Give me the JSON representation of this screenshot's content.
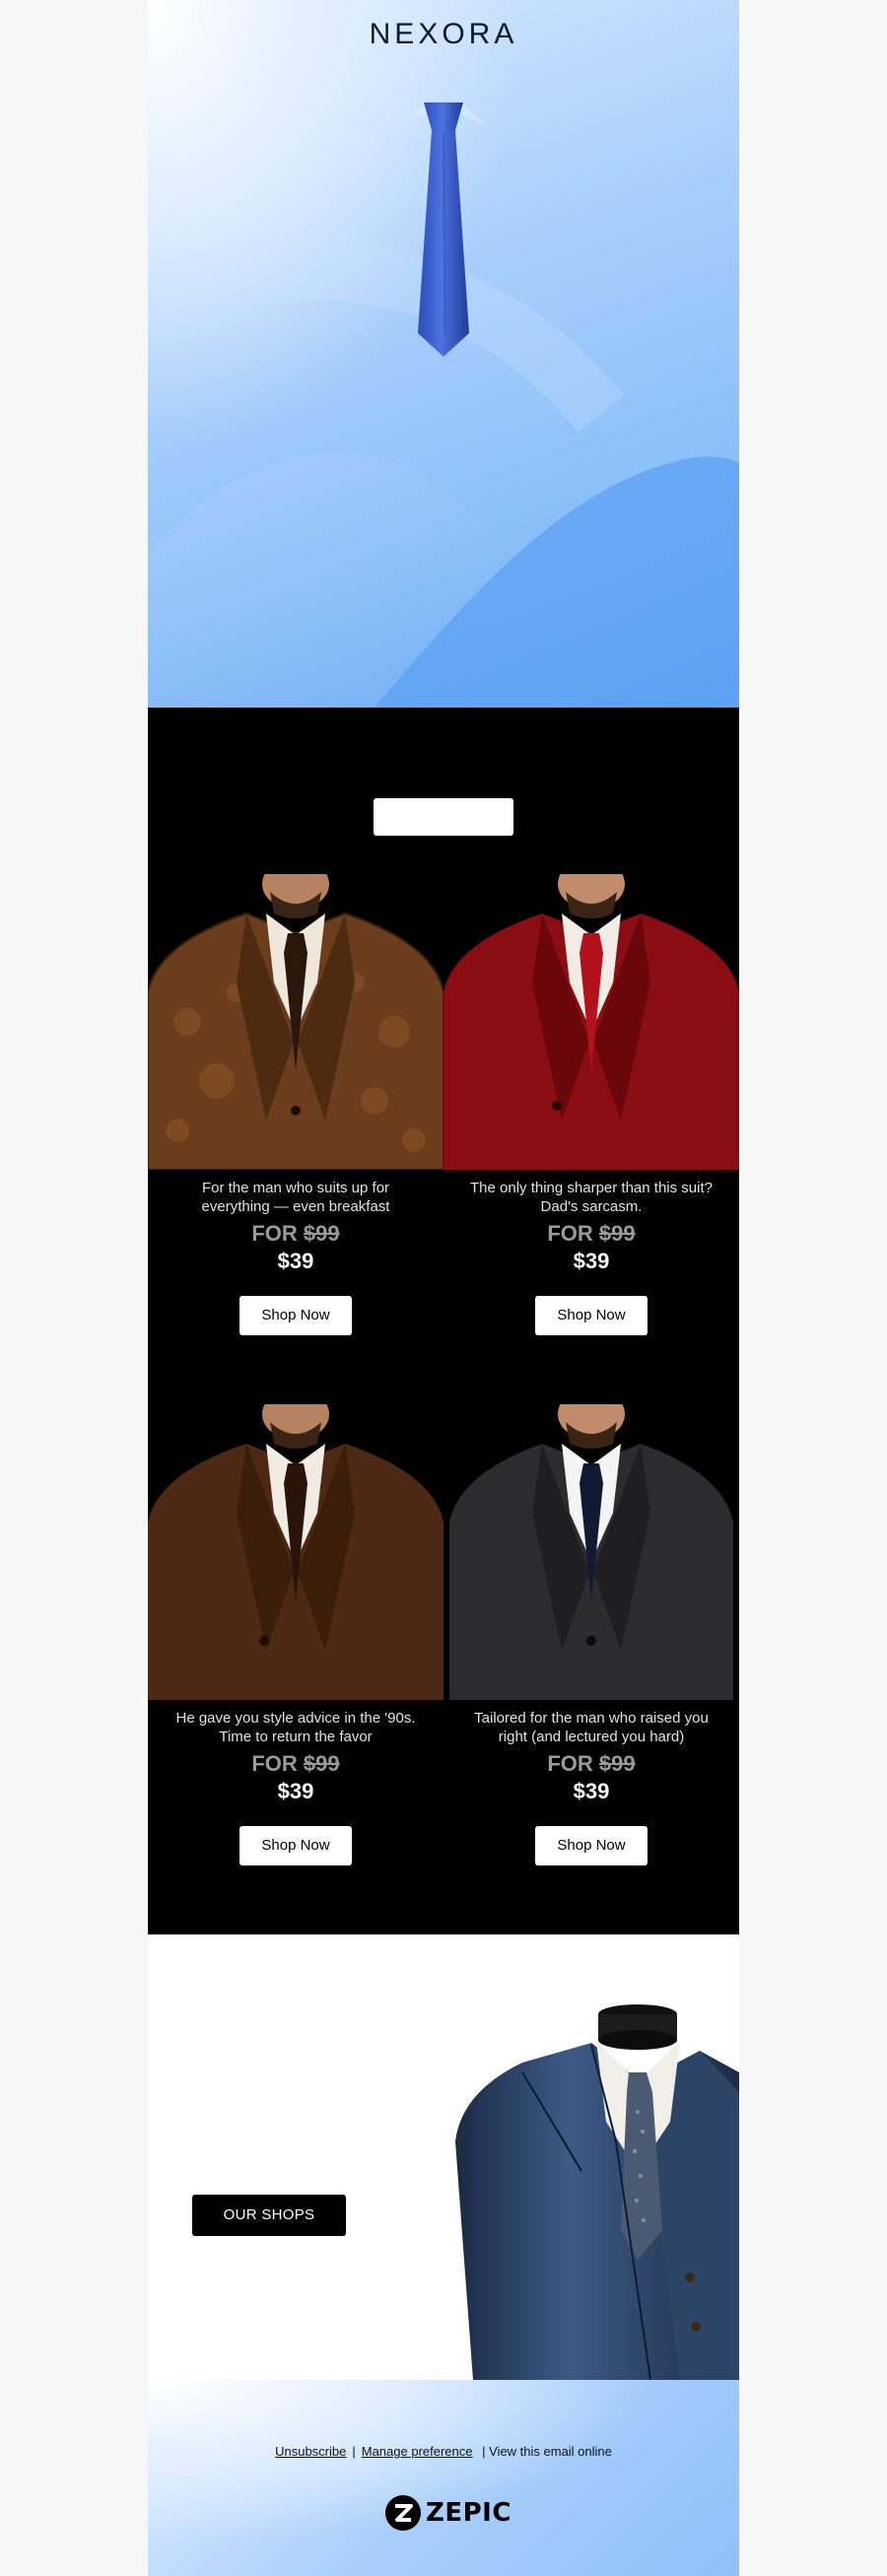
{
  "brand": "NEXORA",
  "hero": {
    "image": "blue-tie-on-blue-background"
  },
  "intro_button": {
    "label": ""
  },
  "products": [
    {
      "image": "brown-paisley-suit",
      "caption": "For the man who suits up for everything — even breakfast",
      "old_price_prefix": "FOR",
      "old_price": "$99",
      "new_price": "$39",
      "cta": "Shop Now"
    },
    {
      "image": "red-suit",
      "caption": "The only thing sharper than this suit? Dad's sarcasm.",
      "old_price_prefix": "FOR",
      "old_price": "$99",
      "new_price": "$39",
      "cta": "Shop Now"
    },
    {
      "image": "brown-suit",
      "caption": "He gave you style advice in the '90s. Time to return the favor",
      "old_price_prefix": "FOR",
      "old_price": "$99",
      "new_price": "$39",
      "cta": "Shop Now"
    },
    {
      "image": "charcoal-suit",
      "caption": "Tailored for the man who raised you right (and lectured you hard)",
      "old_price_prefix": "FOR",
      "old_price": "$99",
      "new_price": "$39",
      "cta": "Shop Now"
    }
  ],
  "shops": {
    "cta": "OUR SHOPS",
    "image": "navy-three-piece-suit-mannequin"
  },
  "footer": {
    "unsubscribe": "Unsubscribe",
    "separator": "|",
    "manage": "Manage preference",
    "view_online": "| View this email online",
    "logo_text": "ZEPIC"
  },
  "colors": {
    "hero_blue": "#8cc0f8",
    "dark_bg": "#000000",
    "button_bg": "#ffffff"
  }
}
